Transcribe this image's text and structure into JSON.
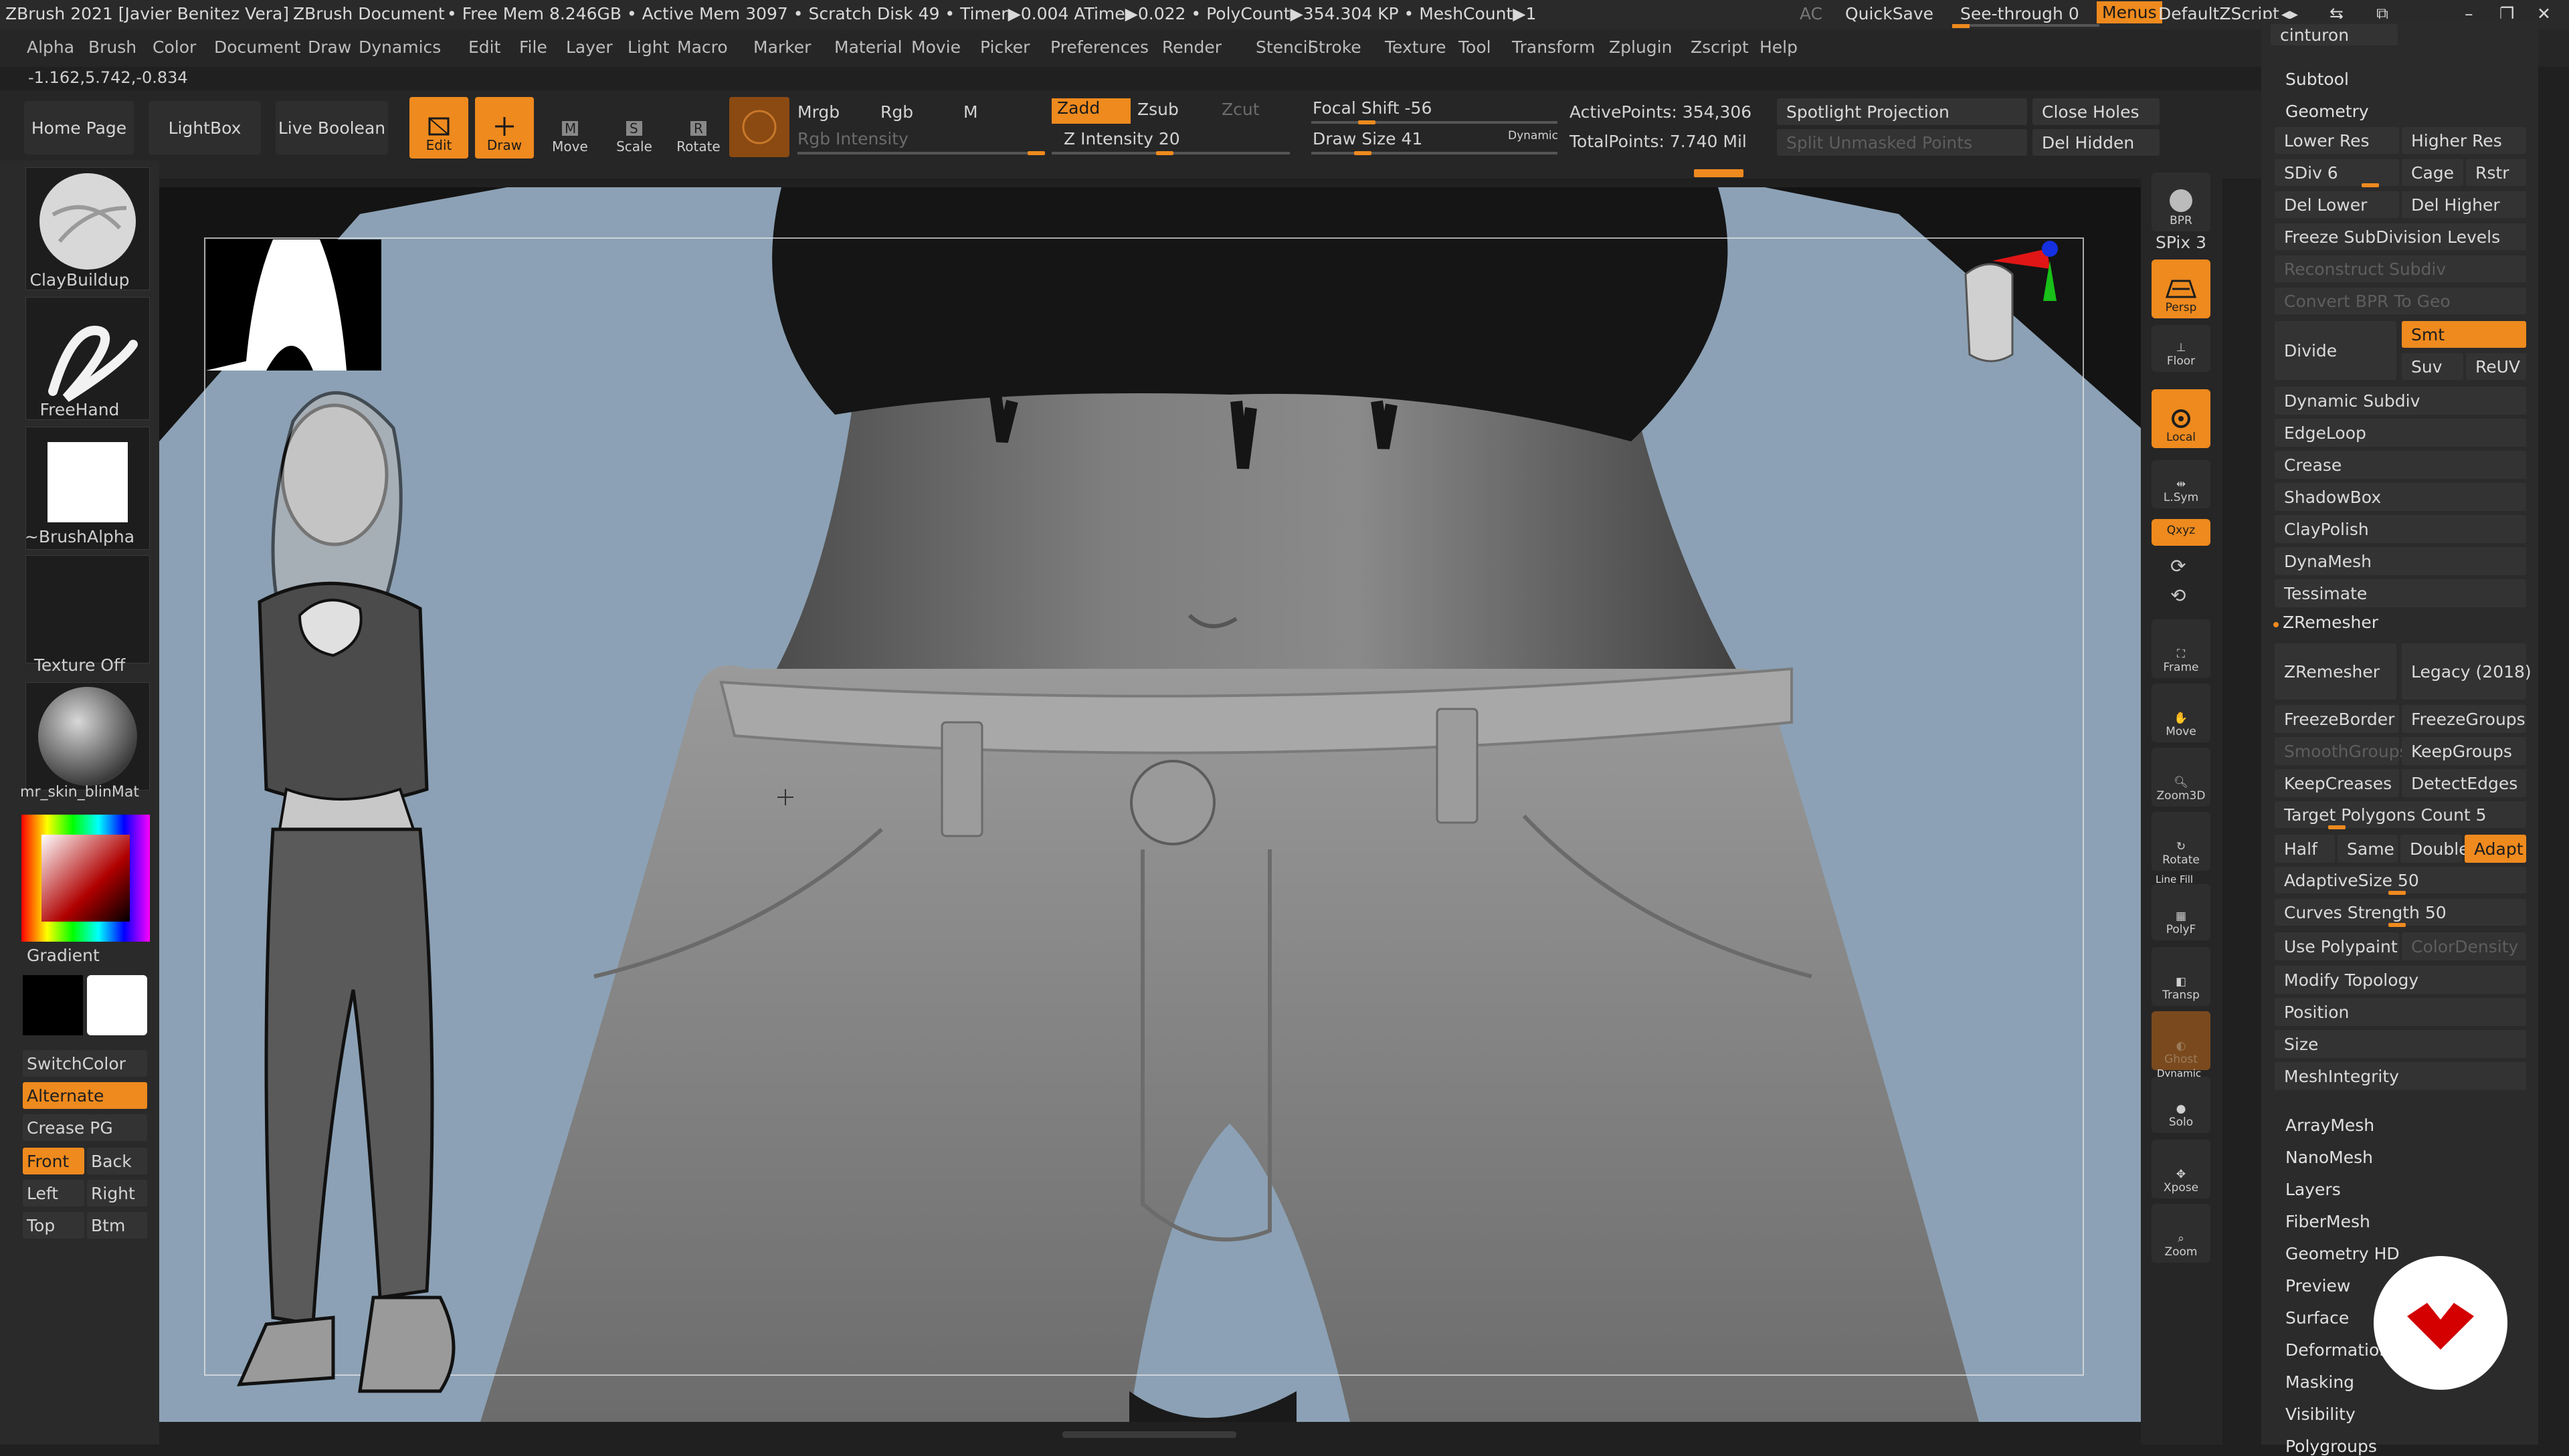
{
  "titlebar": {
    "app": "ZBrush 2021 [Javier Benitez Vera]",
    "document": "ZBrush Document",
    "stats": "• Free Mem 8.246GB • Active Mem 3097 • Scratch Disk 49 • Timer▶0.004 ATime▶0.022 • PolyCount▶354.304 KP • MeshCount▶1",
    "ac": "AC",
    "quicksave": "QuickSave",
    "seethrough": "See-through  0",
    "menus": "Menus",
    "script": "DefaultZScript"
  },
  "menubar": [
    "Alpha",
    "Brush",
    "Color",
    "Document",
    "Draw",
    "Dynamics",
    "Edit",
    "File",
    "Layer",
    "Light",
    "Macro",
    "Marker",
    "Material",
    "Movie",
    "Picker",
    "Preferences",
    "Render",
    "Stencil",
    "Stroke",
    "Texture",
    "Tool",
    "Transform",
    "Zplugin",
    "Zscript",
    "Help"
  ],
  "coords": "-1.162,5.742,-0.834",
  "shelf": {
    "home": "Home Page",
    "lightbox": "LightBox",
    "liveboolean": "Live Boolean",
    "edit": "Edit",
    "draw": "Draw",
    "move": "Move",
    "scale": "Scale",
    "rotate": "Rotate",
    "mrgb": "Mrgb",
    "rgb": "Rgb",
    "m": "M",
    "rgb_intensity": "Rgb Intensity",
    "zadd": "Zadd",
    "zsub": "Zsub",
    "zcut": "Zcut",
    "z_intensity": "Z Intensity 20",
    "focal_shift": "Focal Shift -56",
    "draw_size": "Draw Size 41",
    "dynamic": "Dynamic",
    "active_points": "ActivePoints: 354,306",
    "total_points": "TotalPoints: 7.740 Mil",
    "spotlight": "Spotlight Projection",
    "split_unmasked": "Split Unmasked Points",
    "close_holes": "Close Holes",
    "del_hidden": "Del Hidden"
  },
  "leftpanel": {
    "brush": "ClayBuildup",
    "stroke": "FreeHand",
    "alpha": "~BrushAlpha",
    "texture": "Texture Off",
    "material": "mr_skin_blinMat",
    "gradient": "Gradient",
    "switchcolor": "SwitchColor",
    "alternate": "Alternate",
    "creasepg": "Crease PG",
    "front": "Front",
    "back": "Back",
    "left": "Left",
    "right": "Right",
    "top": "Top",
    "btm": "Btm"
  },
  "righttools": {
    "bpr": "BPR",
    "spix": "SPix 3",
    "persp": "Persp",
    "floor": "Floor",
    "local": "Local",
    "lsym": "L.Sym",
    "xyz": "Qxyz",
    "frame": "Frame",
    "move": "Move",
    "zoom3d": "Zoom3D",
    "rotate": "Rotate",
    "linefill": "Line Fill",
    "polyf": "PolyF",
    "transp": "Transp",
    "ghost": "Ghost",
    "dynamic": "Dynamic",
    "solo": "Solo",
    "xpose": "Xpose",
    "zoom": "Zoom"
  },
  "palette": {
    "top_item": "cinturon",
    "subtool": "Subtool",
    "geometry": "Geometry",
    "lower_res": "Lower Res",
    "higher_res": "Higher Res",
    "sdiv": "SDiv 6",
    "cage": "Cage",
    "rstr": "Rstr",
    "del_lower": "Del Lower",
    "del_higher": "Del Higher",
    "freeze_subdiv": "Freeze SubDivision Levels",
    "reconstruct": "Reconstruct Subdiv",
    "convert_bpr": "Convert BPR To Geo",
    "divide": "Divide",
    "smt": "Smt",
    "suv": "Suv",
    "reuv": "ReUV",
    "dynamic_subdiv": "Dynamic Subdiv",
    "edgeloop": "EdgeLoop",
    "crease": "Crease",
    "shadowbox": "ShadowBox",
    "claypolish": "ClayPolish",
    "dynamesh": "DynaMesh",
    "tessimate": "Tessimate",
    "zremesher_header": "ZRemesher",
    "zremesher_btn": "ZRemesher",
    "legacy": "Legacy (2018)",
    "freezeborder": "FreezeBorder",
    "freezegroups": "FreezeGroups",
    "smoothgroups": "SmoothGroups",
    "keepgroups": "KeepGroups",
    "keepcreases": "KeepCreases",
    "detectedges": "DetectEdges",
    "target_polys": "Target Polygons Count 5",
    "half": "Half",
    "same": "Same",
    "double": "Double",
    "adapt": "Adapt",
    "adaptivesize": "AdaptiveSize 50",
    "curves_strength": "Curves Strength 50",
    "use_polypaint": "Use Polypaint",
    "colordensity": "ColorDensity",
    "modify_topology": "Modify Topology",
    "position": "Position",
    "size": "Size",
    "meshintegrity": "MeshIntegrity",
    "sections": [
      "ArrayMesh",
      "NanoMesh",
      "Layers",
      "FiberMesh",
      "Geometry HD",
      "Preview",
      "Surface",
      "Deformation",
      "Masking",
      "Visibility",
      "Polygroups"
    ]
  },
  "colors": {
    "accent": "#ee8a1e",
    "canvas_bg": "#8ca1b5",
    "panel": "#2b2b2b"
  }
}
